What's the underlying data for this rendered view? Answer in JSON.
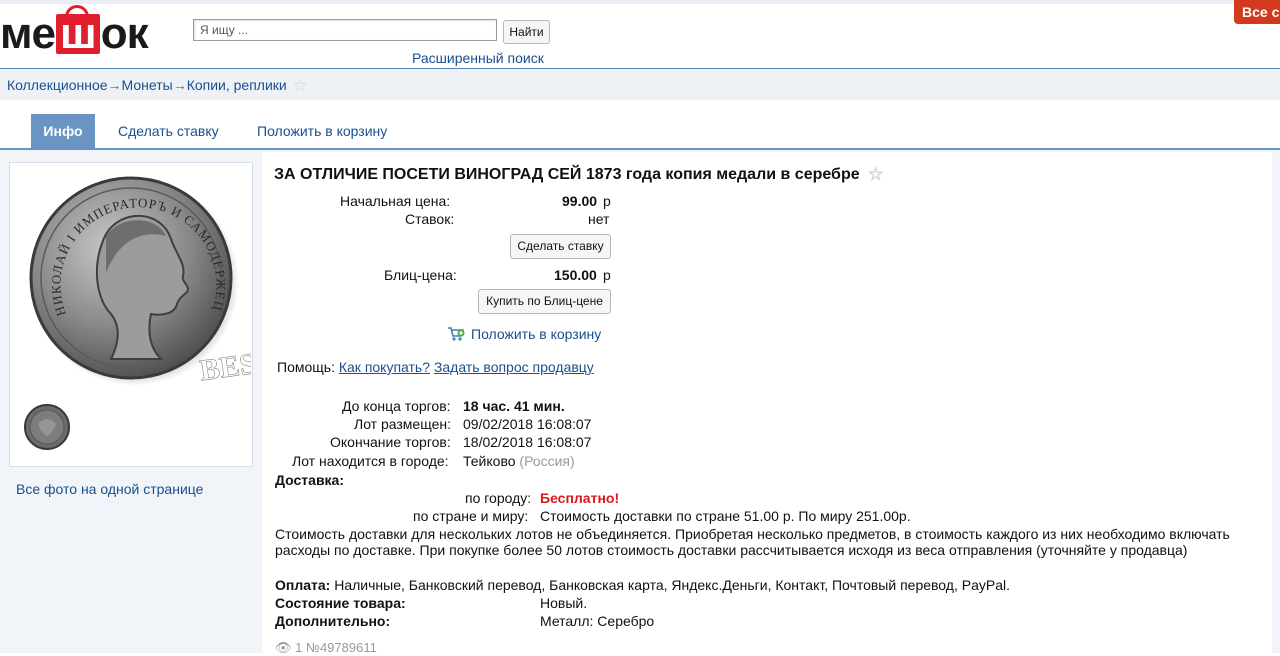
{
  "header": {
    "logo": {
      "pre": "ме",
      "bag": "ш",
      "post": "ок"
    },
    "search_placeholder": "Я ищу ...",
    "search_button": "Найти",
    "advanced_search": "Расширенный поиск",
    "corner_badge": "Все с"
  },
  "breadcrumb": {
    "items": [
      "Коллекционное",
      "Монеты",
      "Копии, реплики"
    ],
    "separator": "→"
  },
  "tabs": {
    "info": "Инфо",
    "bid": "Сделать ставку",
    "cart": "Положить в корзину"
  },
  "left": {
    "all_photos": "Все фото на одной странице",
    "coin_text_outer": "НИКОЛАЙ I ИМПЕРАТОРЪ И САМОДЕРЖЕЦЪ ВСЕРОСС",
    "coin_mark": "BEST"
  },
  "lot": {
    "title": "ЗА ОТЛИЧИЕ ПОСЕТИ ВИНОГРАД СЕЙ 1873 года копия медали в серебре",
    "start_price_label": "Начальная цена:",
    "start_price_value": "99.00",
    "currency": "р",
    "bids_label": "Ставок:",
    "bids_value": "нет",
    "bid_button": "Сделать ставку",
    "blitz_label": "Блиц-цена:",
    "blitz_value": "150.00",
    "blitz_button": "Купить по Блиц-цене",
    "cart_link": "Положить в корзину",
    "help_label": "Помощь:",
    "help_how": "Как покупать?",
    "help_ask": "Задать вопрос продавцу",
    "time_left_label": "До конца торгов:",
    "time_left_value": "18 час. 41 мин.",
    "placed_label": "Лот размещен:",
    "placed_value": "09/02/2018 16:08:07",
    "end_label": "Окончание торгов:",
    "end_value": "18/02/2018 16:08:07",
    "city_label": "Лот находится в городе:",
    "city_value": "Тейково",
    "country_value": "(Россия)",
    "delivery_label": "Доставка:",
    "delivery_city_label": "по городу:",
    "delivery_city_value": "Бесплатно!",
    "delivery_world_label": "по стране и миру:",
    "delivery_world_value": "Стоимость доставки по стране 51.00 р. По миру 251.00р.",
    "delivery_note": "Стоимость доставки для нескольких лотов не объединяется. Приобретая несколько предметов, в стоимость каждого из них необходимо включать расходы по доставке. При покупке более 50 лотов стоимость доставки рассчитывается исходя из веса отправления (уточняйте у продавца)",
    "payment_label": "Оплата:",
    "payment_value": "Наличные, Банковский перевод, Банковская карта, Яндекс.Деньги, Контакт, Почтовый перевод, PayPal.",
    "condition_label": "Состояние товара:",
    "condition_value": "Новый.",
    "extra_label": "Дополнительно:",
    "extra_value": "Металл: Серебро",
    "views": "1",
    "lot_number": "№49789611"
  },
  "colors": {
    "accent": "#6a94c4",
    "link": "#1a4f8f",
    "free": "#d8191c",
    "logo_red": "#e01e2e"
  }
}
